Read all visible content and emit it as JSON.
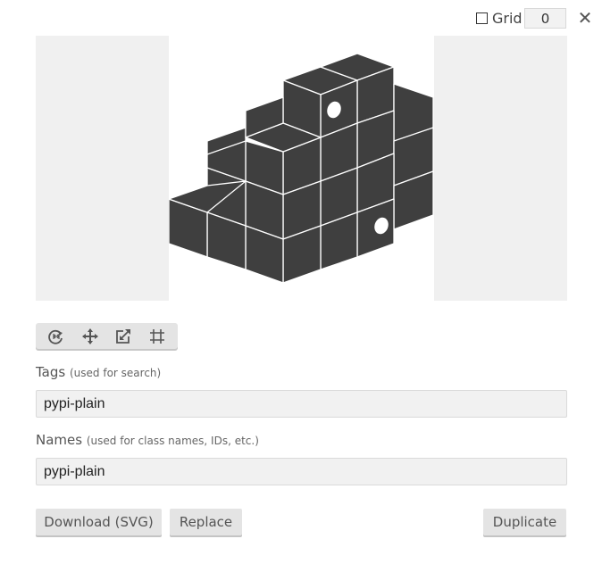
{
  "topbar": {
    "grid_label": "Grid",
    "grid_checked": false,
    "grid_value": "0",
    "close_symbol": "✕"
  },
  "preview": {
    "icon_name": "pypi-plain",
    "icon_color": "#3f3f3f",
    "padding_color": "#f0f0f0"
  },
  "toolbar": {
    "tools": [
      {
        "icon": "rotate-reset-icon"
      },
      {
        "icon": "move-icon"
      },
      {
        "icon": "resize-icon"
      },
      {
        "icon": "crop-icon"
      }
    ]
  },
  "tags": {
    "label": "Tags",
    "hint": "(used for search)",
    "value": "pypi-plain"
  },
  "names": {
    "label": "Names",
    "hint": "(used for class names, IDs, etc.)",
    "value": "pypi-plain"
  },
  "actions": {
    "download_label": "Download (SVG)",
    "replace_label": "Replace",
    "duplicate_label": "Duplicate"
  }
}
